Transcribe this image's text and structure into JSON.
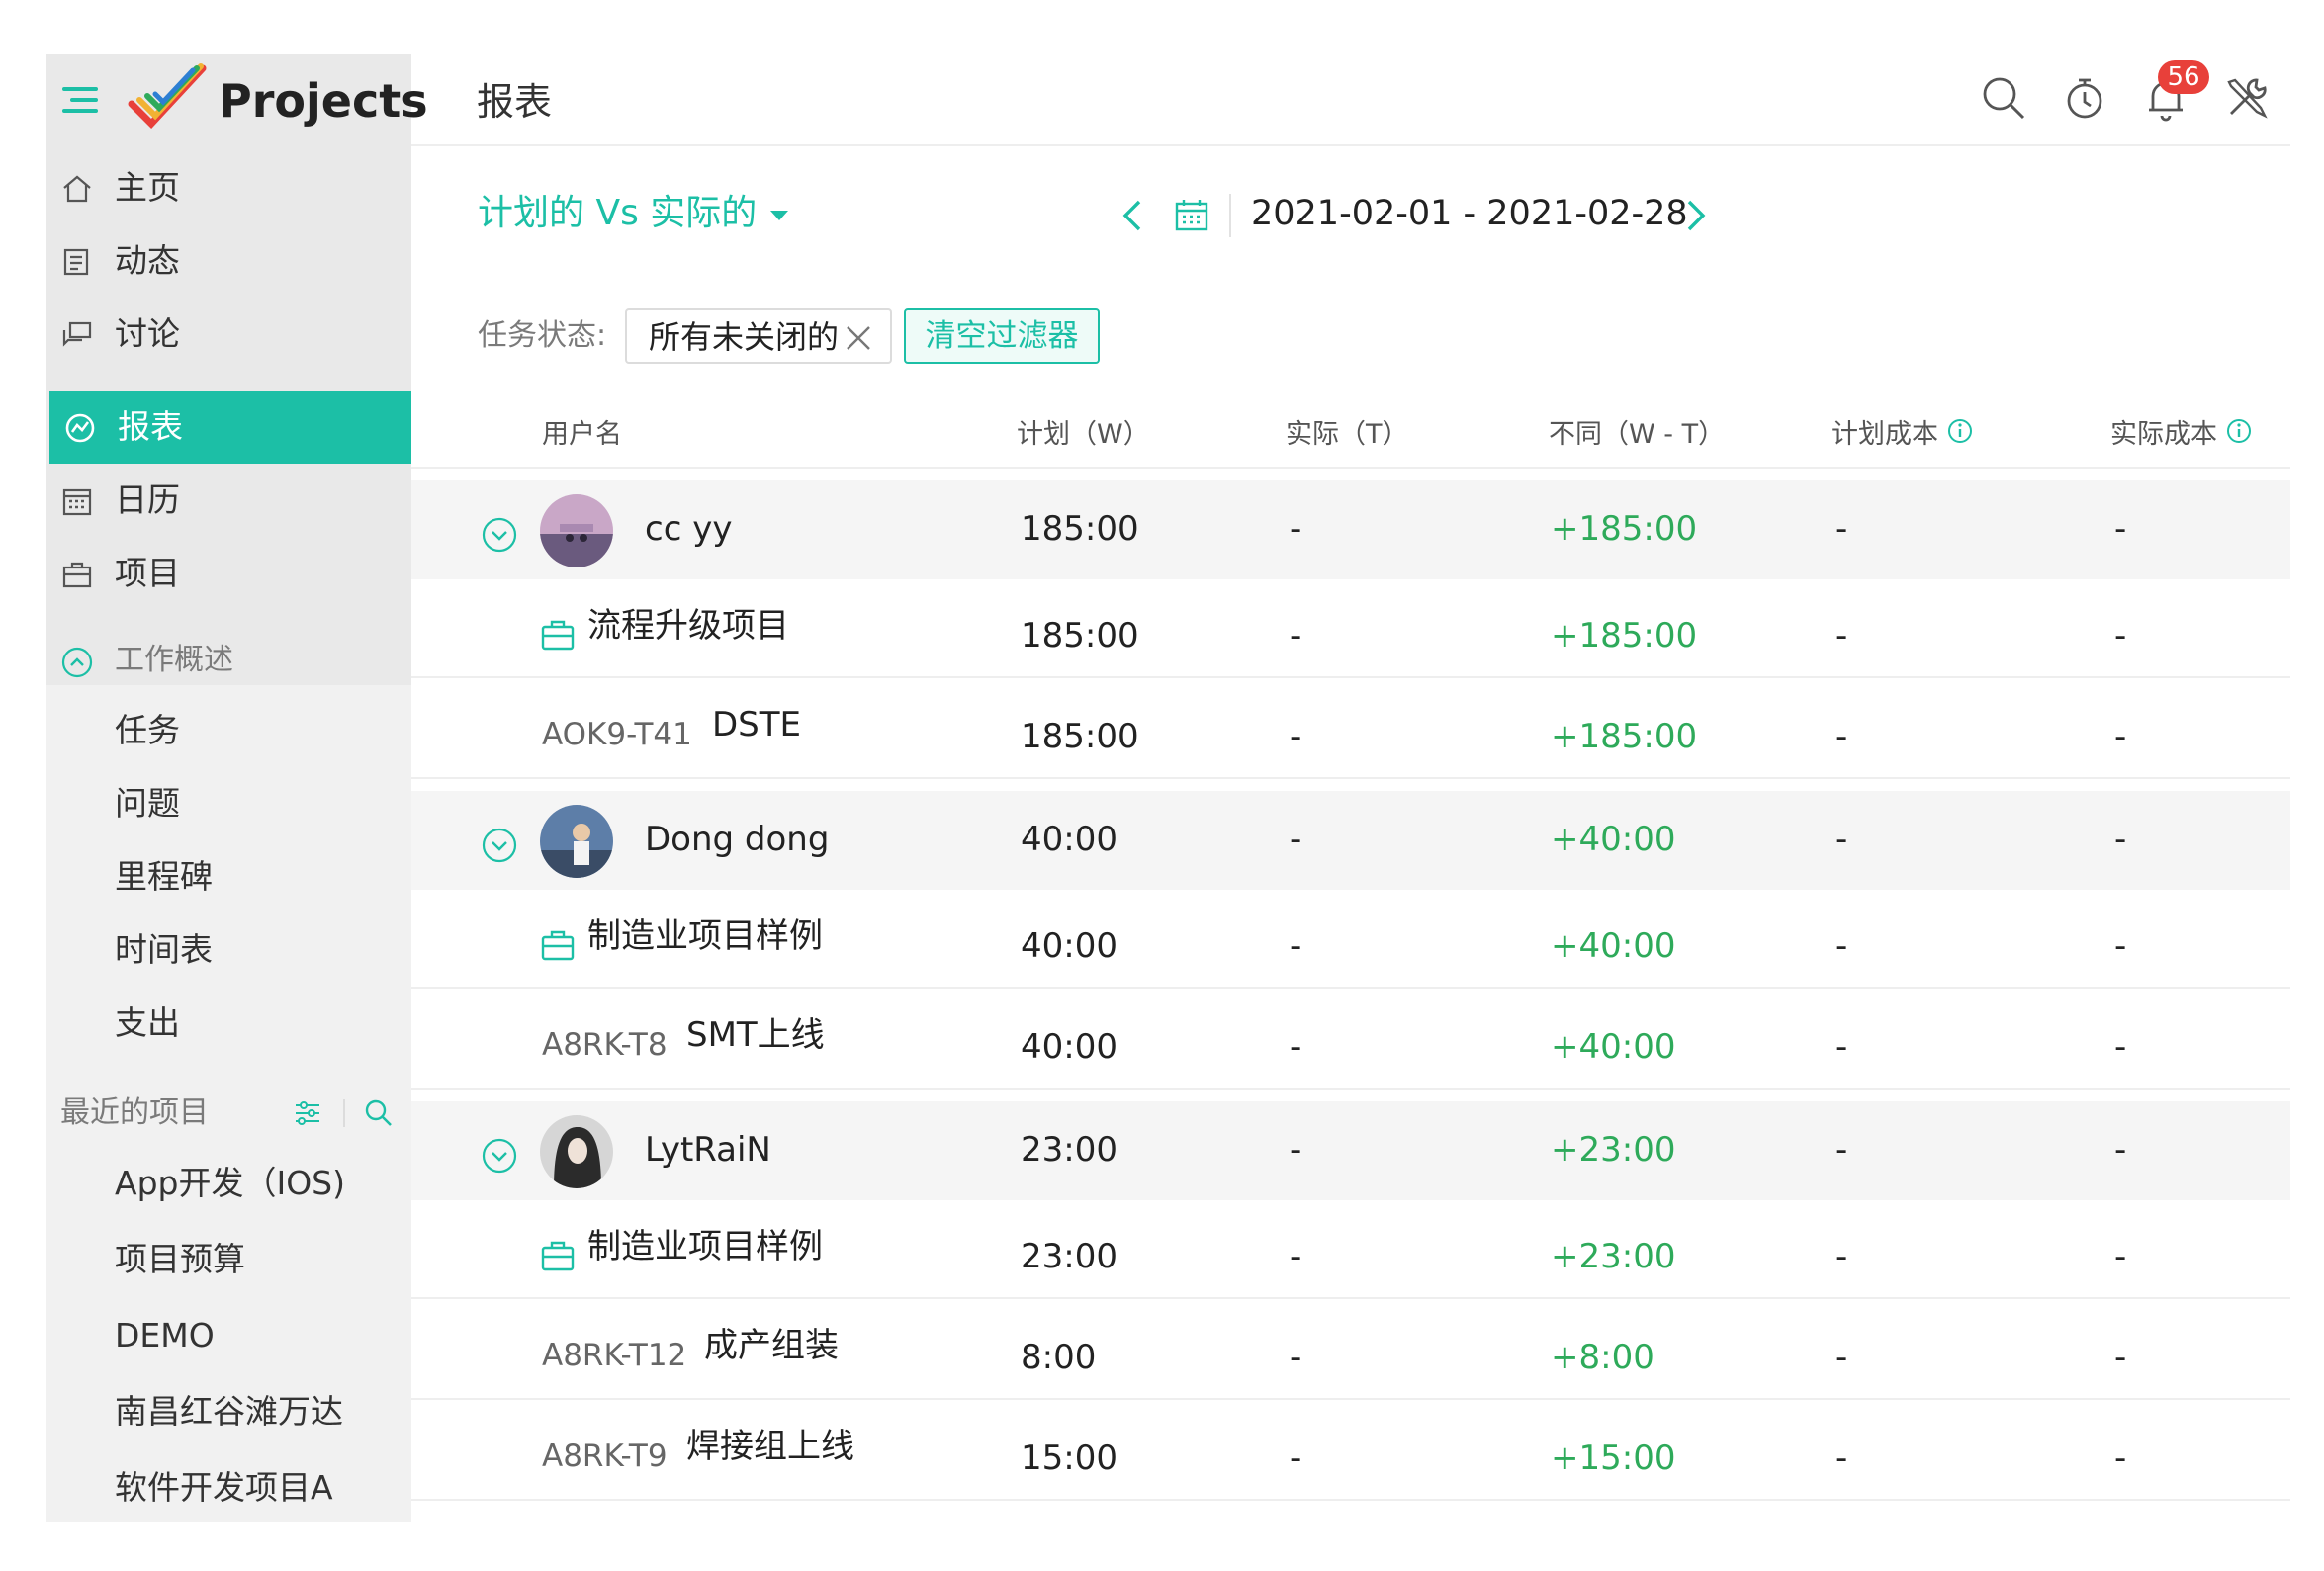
{
  "app": {
    "name": "Projects"
  },
  "header": {
    "title": "报表",
    "notification_count": "56"
  },
  "sidebar": {
    "main": [
      {
        "label": "主页",
        "icon": "home-icon"
      },
      {
        "label": "动态",
        "icon": "feed-icon"
      },
      {
        "label": "讨论",
        "icon": "discussion-icon"
      },
      {
        "label": "报表",
        "icon": "report-icon",
        "active": true
      },
      {
        "label": "日历",
        "icon": "calendar-icon"
      },
      {
        "label": "项目",
        "icon": "briefcase-icon"
      }
    ],
    "work_overview": {
      "label": "工作概述",
      "items": [
        "任务",
        "问题",
        "里程碑",
        "时间表",
        "支出"
      ]
    },
    "recent_projects": {
      "label": "最近的项目",
      "items": [
        "App开发（IOS)",
        "项目预算",
        "DEMO",
        "南昌红谷滩万达",
        "软件开发项目A"
      ]
    }
  },
  "toolbar": {
    "report_type": "计划的 Vs 实际的",
    "date_range": "2021-02-01 - 2021-02-28",
    "filter_label": "任务状态:",
    "filter_value": "所有未关闭的",
    "clear_filters": "清空过滤器"
  },
  "table": {
    "columns": [
      "用户名",
      "计划（W）",
      "实际（T）",
      "不同（W - T）",
      "计划成本",
      "实际成本"
    ],
    "rows": [
      {
        "kind": "user",
        "name": "cc yy",
        "planned": "185:00",
        "actual": "-",
        "diff": "+185:00",
        "planned_cost": "-",
        "actual_cost": "-"
      },
      {
        "kind": "project",
        "name": "流程升级项目",
        "planned": "185:00",
        "actual": "-",
        "diff": "+185:00",
        "planned_cost": "-",
        "actual_cost": "-"
      },
      {
        "kind": "task",
        "id": "AOK9-T41",
        "name": "DSTE",
        "planned": "185:00",
        "actual": "-",
        "diff": "+185:00",
        "planned_cost": "-",
        "actual_cost": "-"
      },
      {
        "kind": "user",
        "name": "Dong dong",
        "planned": "40:00",
        "actual": "-",
        "diff": "+40:00",
        "planned_cost": "-",
        "actual_cost": "-"
      },
      {
        "kind": "project",
        "name": "制造业项目样例",
        "planned": "40:00",
        "actual": "-",
        "diff": "+40:00",
        "planned_cost": "-",
        "actual_cost": "-"
      },
      {
        "kind": "task",
        "id": "A8RK-T8",
        "name": "SMT上线",
        "planned": "40:00",
        "actual": "-",
        "diff": "+40:00",
        "planned_cost": "-",
        "actual_cost": "-"
      },
      {
        "kind": "user",
        "name": "LytRaiN",
        "planned": "23:00",
        "actual": "-",
        "diff": "+23:00",
        "planned_cost": "-",
        "actual_cost": "-"
      },
      {
        "kind": "project",
        "name": "制造业项目样例",
        "planned": "23:00",
        "actual": "-",
        "diff": "+23:00",
        "planned_cost": "-",
        "actual_cost": "-"
      },
      {
        "kind": "task",
        "id": "A8RK-T12",
        "name": "成产组装",
        "planned": "8:00",
        "actual": "-",
        "diff": "+8:00",
        "planned_cost": "-",
        "actual_cost": "-"
      },
      {
        "kind": "task",
        "id": "A8RK-T9",
        "name": "焊接组上线",
        "planned": "15:00",
        "actual": "-",
        "diff": "+15:00",
        "planned_cost": "-",
        "actual_cost": "-"
      }
    ]
  },
  "colors": {
    "accent": "#1cbfa6",
    "positive": "#2eaa5a",
    "badge": "#e8403a"
  }
}
